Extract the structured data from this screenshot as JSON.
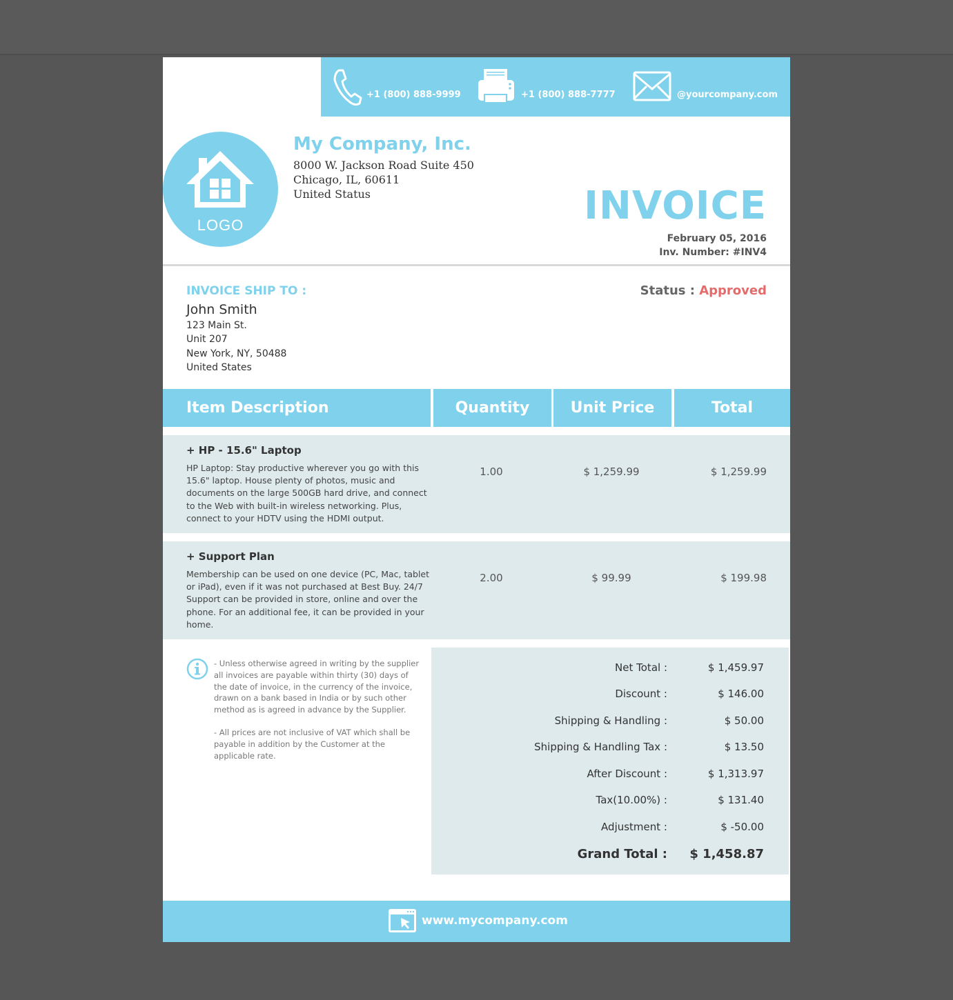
{
  "contact": {
    "phone": "+1 (800) 888-9999",
    "fax": "+1 (800) 888-7777",
    "email": "@yourcompany.com"
  },
  "logo": {
    "text": "LOGO",
    "icon": "house-icon"
  },
  "company": {
    "name": "My Company, Inc.",
    "address_line1": "8000 W. Jackson Road Suite 450",
    "address_line2": "Chicago, IL, 60611",
    "address_line3": "United Status"
  },
  "invoice": {
    "title": "INVOICE",
    "date": "February 05, 2016",
    "number_label": "Inv. Number:",
    "number": "#INV4"
  },
  "ship_to": {
    "label": "INVOICE SHIP TO :",
    "name": "John Smith",
    "line1": "123 Main St.",
    "line2": "Unit 207",
    "line3": "New York, NY, 50488",
    "line4": "United States"
  },
  "status": {
    "label": "Status :",
    "value": "Approved"
  },
  "table": {
    "headers": [
      "Item Description",
      "Quantity",
      "Unit Price",
      "Total"
    ],
    "items": [
      {
        "title": "+ HP - 15.6\" Laptop",
        "description": "HP Laptop: Stay productive wherever you go with this 15.6\" laptop. House plenty of photos, music and documents on the large 500GB hard drive, and connect to the Web with built-in wireless networking. Plus, connect to your HDTV using the HDMI output.",
        "quantity": "1.00",
        "unit_price": "$ 1,259.99",
        "total": "$ 1,259.99"
      },
      {
        "title": "+ Support Plan",
        "description": "Membership can be used on one device (PC, Mac, tablet or iPad), even if it was not purchased at Best Buy. 24/7 Support can be provided in store, online and over the phone. For an additional fee, it can be provided in your home.",
        "quantity": "2.00",
        "unit_price": "$ 99.99",
        "total": "$ 199.98"
      }
    ]
  },
  "notes": {
    "note1": "- Unless otherwise agreed in writing by the supplier all invoices are payable within thirty (30) days of the date of invoice, in the currency of the invoice, drawn on a bank based in India or by such other method as is agreed in advance by the Supplier.",
    "note2": "- All prices are not inclusive of VAT which shall be payable in addition by the Customer at the applicable rate."
  },
  "totals": [
    {
      "label": "Net Total :",
      "value": "$ 1,459.97"
    },
    {
      "label": "Discount :",
      "value": "$ 146.00"
    },
    {
      "label": "Shipping & Handling :",
      "value": "$ 50.00"
    },
    {
      "label": "Shipping & Handling Tax :",
      "value": "$ 13.50"
    },
    {
      "label": "After Discount :",
      "value": "$ 1,313.97"
    },
    {
      "label": "Tax(10.00%) :",
      "value": "$ 131.40"
    },
    {
      "label": "Adjustment :",
      "value": "$ -50.00"
    },
    {
      "label": "Grand Total :",
      "value": "$ 1,458.87"
    }
  ],
  "footer": {
    "website": "www.mycompany.com"
  },
  "colors": {
    "accent": "#7fd1ec",
    "row_bg": "#dfeaec",
    "status": "#e46b6b",
    "backdrop": "#565656"
  }
}
